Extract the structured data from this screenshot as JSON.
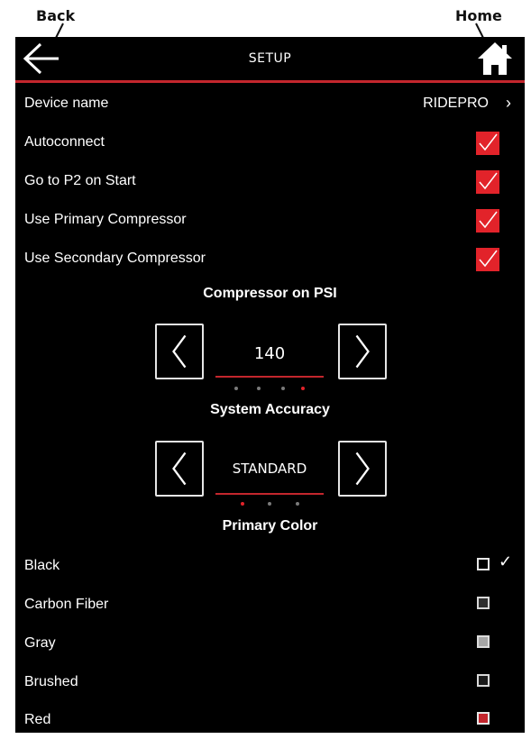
{
  "callouts": {
    "back": "Back",
    "home": "Home"
  },
  "header": {
    "title": "SETUP"
  },
  "settings": [
    {
      "label": "Device name",
      "value": "RIDEPRO",
      "chevron": "›"
    },
    {
      "label": "Autoconnect",
      "checked": true
    },
    {
      "label": "Go to P2 on Start",
      "checked": true
    },
    {
      "label": "Use Primary Compressor",
      "checked": true
    },
    {
      "label": "Use Secondary Compressor",
      "checked": true
    }
  ],
  "compressor": {
    "heading": "Compressor on PSI",
    "value": "140",
    "dots_active": 4,
    "dots_total": 4
  },
  "accuracy": {
    "heading": "System Accuracy",
    "value": "STANDARD",
    "dots_active": 1,
    "dots_total": 3
  },
  "primary_color": {
    "heading": "Primary Color",
    "options": [
      {
        "label": "Black",
        "selected": true,
        "swatch": "#000000",
        "border": "#e6e6e6"
      },
      {
        "label": "Carbon Fiber",
        "selected": false,
        "swatch": "#2f2f2f",
        "border": "#d8d8d8"
      },
      {
        "label": "Gray",
        "selected": false,
        "swatch": "#a6a6a6",
        "border": "#dcdcdc"
      },
      {
        "label": "Brushed",
        "selected": false,
        "swatch": "#1a1a1a",
        "border": "#d8d8d8"
      },
      {
        "label": "Red",
        "selected": false,
        "swatch": "#c3262d",
        "border": "#e6e6e6"
      }
    ],
    "check_glyph": "✓"
  },
  "colors": {
    "accent": "#e2232a",
    "divider": "#c3262d",
    "background": "#000000"
  }
}
